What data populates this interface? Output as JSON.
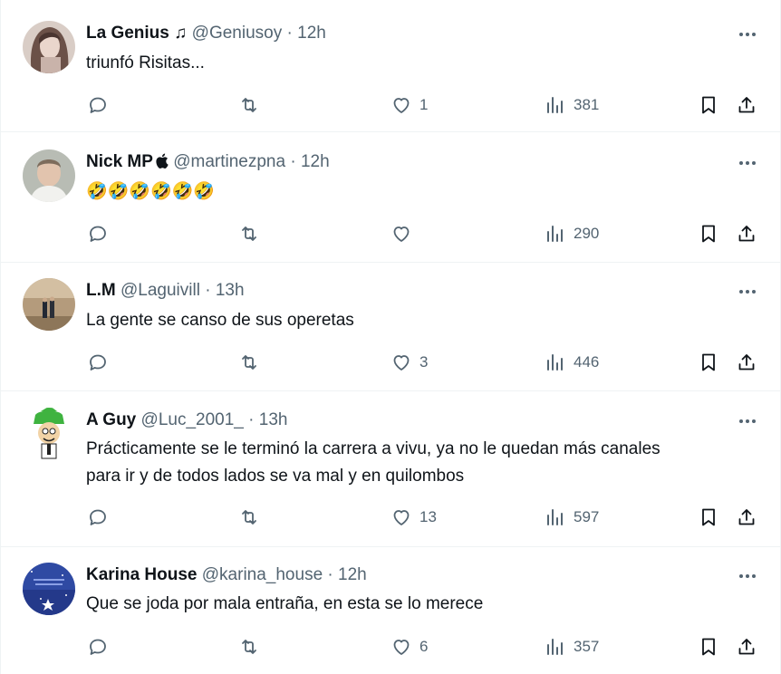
{
  "tweets": [
    {
      "name": "La Genius ♫",
      "handle": "@Geniusoy",
      "separator": "·",
      "time": "12h",
      "text": "triunfó Risitas...",
      "replies": "",
      "retweets": "",
      "likes": "1",
      "views": "381",
      "avatar": "woman-with-hair-avatar"
    },
    {
      "name": "Nick MP",
      "handle": "@martinezpna",
      "separator": "·",
      "time": "12h",
      "text": "🤣🤣🤣🤣🤣🤣",
      "replies": "",
      "retweets": "",
      "likes": "",
      "views": "290",
      "avatar": "man-portrait-avatar",
      "badge": "apple-icon"
    },
    {
      "name": "L.M",
      "handle": "@Laguivill",
      "separator": "·",
      "time": "13h",
      "text": "La gente se canso de sus operetas",
      "replies": "",
      "retweets": "",
      "likes": "3",
      "views": "446",
      "avatar": "two-people-hallway-avatar"
    },
    {
      "name": "A Guy",
      "handle": "@Luc_2001_",
      "separator": "·",
      "time": "13h",
      "text_lines": [
        "Prácticamente se le terminó la carrera a vivu, ya no le quedan más canales",
        "para ir y de todos lados se va mal y en quilombos"
      ],
      "replies": "",
      "retweets": "",
      "likes": "13",
      "views": "597",
      "avatar": "cartoon-character-avatar"
    },
    {
      "name": "Karina House",
      "handle": "@karina_house",
      "separator": "·",
      "time": "12h",
      "text": "Que se joda por mala entraña, en esta se lo merece",
      "replies": "",
      "retweets": "",
      "likes": "6",
      "views": "357",
      "avatar": "starry-night-avatar"
    }
  ],
  "colors": {
    "text": "#0f1419",
    "secondary": "#536471",
    "border": "#eff3f4"
  }
}
